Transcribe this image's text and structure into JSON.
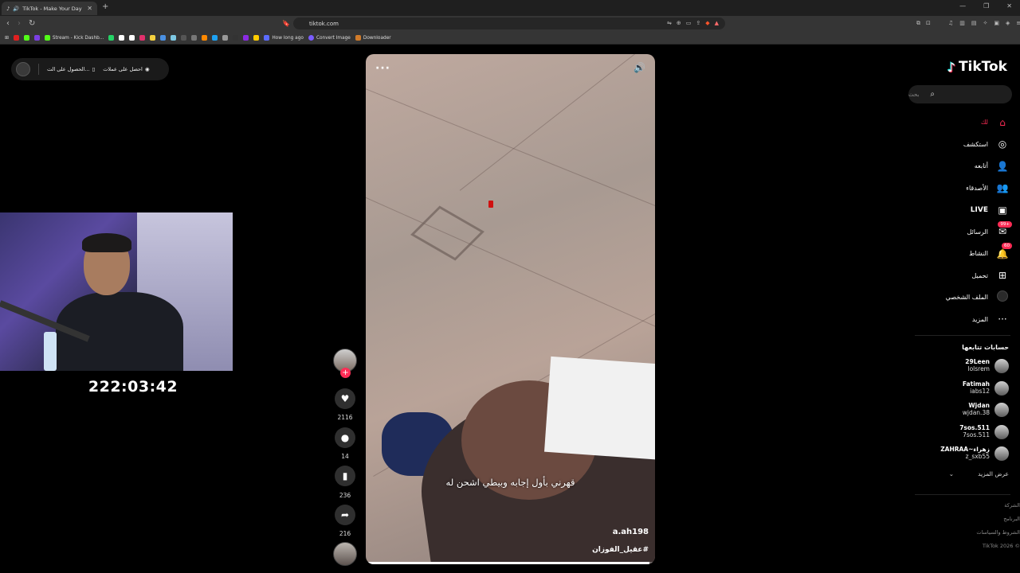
{
  "browser": {
    "tab_title": "TikTok - Make Your Day",
    "url": "tiktok.com",
    "bookmarks": [
      {
        "label": "Stream - Kick Dashb...",
        "color": "#53fc18"
      },
      {
        "label": "How long ago",
        "color": "#5b6bff"
      },
      {
        "label": "Convert Image",
        "color": "#7a5cff"
      },
      {
        "label": "Downloader",
        "color": "#d07b2a"
      }
    ],
    "bookmark_icon_colors": [
      "#e02020",
      "#53fc18",
      "#7b3fe4",
      "#25d366",
      "#ffffff",
      "#ffffff",
      "#e1306c",
      "#f4d03f",
      "#4a90e2",
      "#7ec8e3",
      "#555",
      "#777",
      "#ff8800",
      "#1da1f2",
      "#999",
      "#333",
      "#8a2be2",
      "#ffcc00"
    ]
  },
  "promo": {
    "item1": "احصل على عملات",
    "item2": "الحصول على الت..."
  },
  "timer": "222:03:42",
  "video": {
    "caption": "قهرني بأول إجابه وبيطي اشحن له",
    "author": "a.ah198",
    "hashtag": "#عقيل_الفوزان",
    "progress": 0.98
  },
  "actions": {
    "likes": "2116",
    "comments": "14",
    "saves": "236",
    "shares": "216"
  },
  "sidebar": {
    "logo": "TikTok",
    "search_placeholder": "بحث",
    "nav": [
      {
        "label": "لك",
        "icon": "home-icon",
        "glyph": "⌂",
        "active": true
      },
      {
        "label": "استكشف",
        "icon": "compass-icon",
        "glyph": "◎"
      },
      {
        "label": "أتابعه",
        "icon": "user-follow-icon",
        "glyph": "👤"
      },
      {
        "label": "الأصدقاء",
        "icon": "friends-icon",
        "glyph": "👥"
      },
      {
        "label": "LIVE",
        "icon": "live-icon",
        "glyph": "▣",
        "bold": true
      },
      {
        "label": "الرسائل",
        "icon": "messages-icon",
        "glyph": "✉",
        "badge": "99+"
      },
      {
        "label": "النشاط",
        "icon": "activity-icon",
        "glyph": "🔔",
        "badge": "60"
      },
      {
        "label": "تحميل",
        "icon": "upload-icon",
        "glyph": "⊞"
      },
      {
        "label": "الملف الشخصي",
        "icon": "profile-icon",
        "glyph": ""
      },
      {
        "label": "المزيد",
        "icon": "more-icon",
        "glyph": "···"
      }
    ],
    "following_title": "حسابات تتابعها",
    "following": [
      {
        "name": "29Leen",
        "handle": "lolsrem"
      },
      {
        "name": "Fatimah",
        "handle": "iabs12"
      },
      {
        "name": "Wjdan",
        "handle": "wjdan.38"
      },
      {
        "name": "7sos.511",
        "handle": "7sos.511"
      },
      {
        "name": "ZAHRAA~زهراء",
        "handle": "z_sxb55"
      }
    ],
    "see_more": "عرض المزيد",
    "footer": [
      "الشركة",
      "البرنامج",
      "الشروط والسياسات",
      "© TikTok 2026"
    ]
  }
}
